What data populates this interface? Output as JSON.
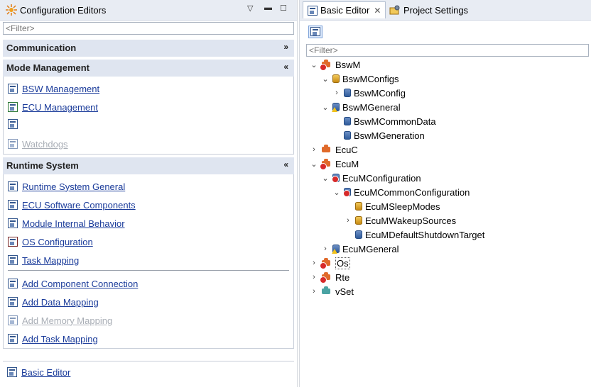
{
  "left_panel": {
    "title": "Configuration Editors",
    "filter_placeholder": "<Filter>",
    "sections": [
      {
        "title": "Communication",
        "expanded": false
      },
      {
        "title": "Mode Management",
        "expanded": true,
        "items": [
          {
            "label": "BSW Management",
            "enabled": true
          },
          {
            "label": "ECU Management",
            "enabled": true
          },
          {
            "label": "",
            "enabled": true
          },
          {
            "label": "Watchdogs",
            "enabled": false
          }
        ]
      },
      {
        "title": "Runtime System",
        "expanded": true,
        "items": [
          {
            "label": "Runtime System General",
            "enabled": true
          },
          {
            "label": "ECU Software Components",
            "enabled": true
          },
          {
            "label": "Module Internal Behavior",
            "enabled": true
          },
          {
            "label": "OS Configuration",
            "enabled": true
          },
          {
            "label": "Task Mapping",
            "enabled": true
          },
          {
            "label": "Add Component Connection",
            "enabled": true
          },
          {
            "label": "Add Data Mapping",
            "enabled": true
          },
          {
            "label": "Add Memory Mapping",
            "enabled": false
          },
          {
            "label": "Add Task Mapping",
            "enabled": true
          }
        ]
      }
    ],
    "footer_link": "Basic Editor"
  },
  "right_panel": {
    "tabs": [
      {
        "label": "Basic Editor",
        "active": true,
        "closable": true
      },
      {
        "label": "Project Settings",
        "active": false
      }
    ],
    "filter_placeholder": "<Filter>",
    "tree": [
      {
        "label": "BswM",
        "level": 0,
        "twisty": "expanded",
        "icon": "module-error-icon"
      },
      {
        "label": "BswMConfigs",
        "level": 1,
        "twisty": "expanded",
        "icon": "container-folder-icon"
      },
      {
        "label": "BswMConfig",
        "level": 2,
        "twisty": "collapsed",
        "icon": "container-icon"
      },
      {
        "label": "BswMGeneral",
        "level": 1,
        "twisty": "expanded",
        "icon": "container-warning-icon"
      },
      {
        "label": "BswMCommonData",
        "level": 2,
        "twisty": "none",
        "icon": "container-icon"
      },
      {
        "label": "BswMGeneration",
        "level": 2,
        "twisty": "none",
        "icon": "container-icon"
      },
      {
        "label": "EcuC",
        "level": 0,
        "twisty": "collapsed",
        "icon": "module-icon"
      },
      {
        "label": "EcuM",
        "level": 0,
        "twisty": "expanded",
        "icon": "module-error-icon"
      },
      {
        "label": "EcuMConfiguration",
        "level": 1,
        "twisty": "expanded",
        "icon": "container-error-icon"
      },
      {
        "label": "EcuMCommonConfiguration",
        "level": 2,
        "twisty": "expanded",
        "icon": "container-error-icon"
      },
      {
        "label": "EcuMSleepModes",
        "level": 3,
        "twisty": "none",
        "icon": "container-folder-icon"
      },
      {
        "label": "EcuMWakeupSources",
        "level": 3,
        "twisty": "collapsed",
        "icon": "container-folder-icon"
      },
      {
        "label": "EcuMDefaultShutdownTarget",
        "level": 3,
        "twisty": "none",
        "icon": "container-icon"
      },
      {
        "label": "EcuMGeneral",
        "level": 1,
        "twisty": "collapsed",
        "icon": "container-warning-icon"
      },
      {
        "label": "Os",
        "level": 0,
        "twisty": "collapsed",
        "icon": "module-error-icon",
        "selected": true
      },
      {
        "label": "Rte",
        "level": 0,
        "twisty": "collapsed",
        "icon": "module-error-icon"
      },
      {
        "label": "vSet",
        "level": 0,
        "twisty": "collapsed",
        "icon": "module-teal-icon"
      }
    ]
  }
}
